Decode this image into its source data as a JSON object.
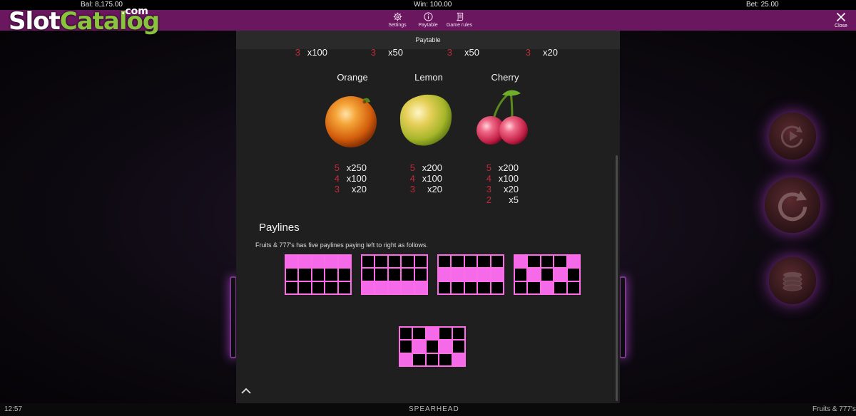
{
  "status": {
    "balance": "Bal: 8,175.00",
    "win": "Win: 100.00",
    "bet": "Bet: 25.00"
  },
  "logo": {
    "slot": "Slot",
    "catalog": "Catalog",
    "dotcom": ".com"
  },
  "menu": {
    "settings": "Settings",
    "paytable": "Paytable",
    "game_rules": "Game rules",
    "close": "Close"
  },
  "panel": {
    "title": "Paytable",
    "top_row": [
      {
        "count": "3",
        "mult": "x100"
      },
      {
        "count": "3",
        "mult": "x50"
      },
      {
        "count": "3",
        "mult": "x50"
      },
      {
        "count": "3",
        "mult": "x20"
      }
    ],
    "symbols": [
      {
        "name": "Orange",
        "icon": "orange-icon",
        "pays": [
          {
            "count": "5",
            "mult": "x250"
          },
          {
            "count": "4",
            "mult": "x100"
          },
          {
            "count": "3",
            "mult": "x20"
          }
        ]
      },
      {
        "name": "Lemon",
        "icon": "lemon-icon",
        "pays": [
          {
            "count": "5",
            "mult": "x200"
          },
          {
            "count": "4",
            "mult": "x100"
          },
          {
            "count": "3",
            "mult": "x20"
          }
        ]
      },
      {
        "name": "Cherry",
        "icon": "cherry-icon",
        "pays": [
          {
            "count": "5",
            "mult": "x200"
          },
          {
            "count": "4",
            "mult": "x100"
          },
          {
            "count": "3",
            "mult": "x20"
          },
          {
            "count": "2",
            "mult": "x5"
          }
        ]
      }
    ],
    "paylines_heading": "Paylines",
    "paylines_desc": "Fruits & 777's has five paylines paying left to right as follows.",
    "paylines": [
      [
        [
          1,
          1,
          1,
          1,
          1
        ],
        [
          0,
          0,
          0,
          0,
          0
        ],
        [
          0,
          0,
          0,
          0,
          0
        ]
      ],
      [
        [
          0,
          0,
          0,
          0,
          0
        ],
        [
          0,
          0,
          0,
          0,
          0
        ],
        [
          1,
          1,
          1,
          1,
          1
        ]
      ],
      [
        [
          0,
          0,
          0,
          0,
          0
        ],
        [
          1,
          1,
          1,
          1,
          1
        ],
        [
          0,
          0,
          0,
          0,
          0
        ]
      ],
      [
        [
          1,
          0,
          0,
          0,
          1
        ],
        [
          0,
          1,
          0,
          1,
          0
        ],
        [
          0,
          0,
          1,
          0,
          0
        ]
      ],
      [
        [
          0,
          0,
          1,
          0,
          0
        ],
        [
          0,
          1,
          0,
          1,
          0
        ],
        [
          1,
          0,
          0,
          0,
          1
        ]
      ]
    ]
  },
  "footer": {
    "time": "12:57",
    "brand": "SPEARHEAD",
    "game": "Fruits & 777's"
  },
  "colors": {
    "menu_bar": "#6b1760",
    "payline_on": "#f46ae8",
    "count_red": "#c02a3a",
    "logo_green": "#8ac43f"
  }
}
